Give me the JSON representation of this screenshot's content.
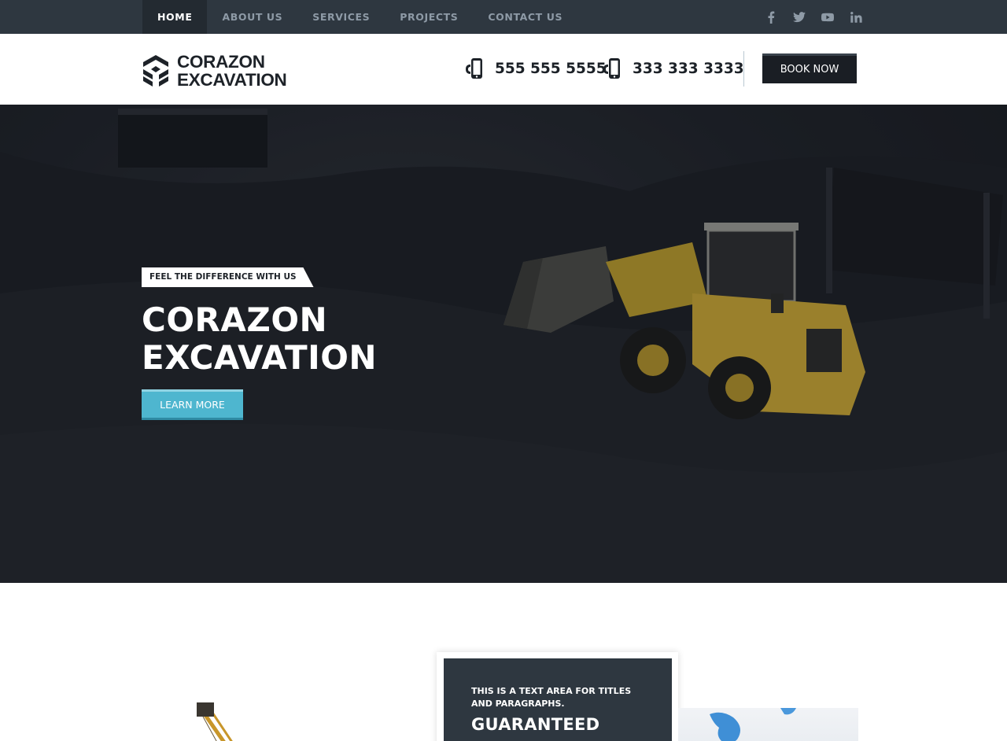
{
  "top_nav": {
    "items": [
      {
        "label": "HOME",
        "active": true
      },
      {
        "label": "ABOUT US",
        "active": false
      },
      {
        "label": "SERVICES",
        "active": false
      },
      {
        "label": "PROJECTS",
        "active": false
      },
      {
        "label": "CONTACT US",
        "active": false
      }
    ],
    "social_icons": [
      "facebook-icon",
      "twitter-icon",
      "youtube-icon",
      "linkedin-icon"
    ]
  },
  "header": {
    "logo_line1": "CORAZON",
    "logo_line2": "EXCAVATION",
    "phone1": "555 555 5555",
    "phone2": "333 333 3333",
    "book_button": "BOOK NOW"
  },
  "hero": {
    "tagline": "FEEL THE DIFFERENCE WITH US",
    "title_line1": "CORAZON",
    "title_line2": "EXCAVATION",
    "cta_button": "LEARN MORE"
  },
  "feature_card": {
    "small_text": "THIS IS A TEXT AREA FOR TITLES AND PARAGRAPHS.",
    "heading": "GUARANTEED"
  },
  "colors": {
    "topbar_bg": "#2e3740",
    "accent_cyan": "#4eb6cf",
    "dark_button": "#1a1e24",
    "text_dark": "#1d2228"
  }
}
